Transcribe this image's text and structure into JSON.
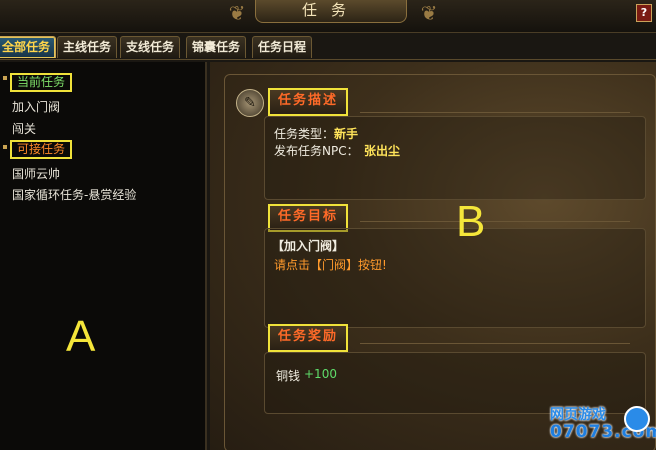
{
  "window": {
    "title": "任务",
    "help_label": "?"
  },
  "tabs": [
    {
      "label": "全部任务",
      "active": true
    },
    {
      "label": "主线任务",
      "active": false
    },
    {
      "label": "支线任务",
      "active": false
    },
    {
      "label": "锦囊任务",
      "active": false
    },
    {
      "label": "任务日程",
      "active": false
    }
  ],
  "quest_list": {
    "current_header": "当前任务",
    "current_items": [
      "加入门阀",
      "闯关"
    ],
    "available_header": "可接任务",
    "available_items": [
      "国师云帅",
      "国家循环任务-悬赏经验"
    ]
  },
  "annotations": {
    "left_label": "A",
    "right_label": "B"
  },
  "detail": {
    "description_title": "任务描述",
    "type_label": "任务类型：",
    "type_value": "新手",
    "npc_label": "发布任务NPC：",
    "npc_value": "张出尘",
    "goal_title": "任务目标",
    "goal_name": "【加入门阀】",
    "goal_text": "请点击【门阀】按钮!",
    "reward_title": "任务奖励",
    "reward_label": "铜钱",
    "reward_value": "+100"
  },
  "watermark": {
    "line1": "网页游戏",
    "line2": "07073.com"
  },
  "colors": {
    "highlight_box": "#f0e23a",
    "section_title": "#ff6a28",
    "current_quest": "#7fe06a",
    "available_quest": "#ff8a2a",
    "reward_value": "#5fdc6a"
  }
}
